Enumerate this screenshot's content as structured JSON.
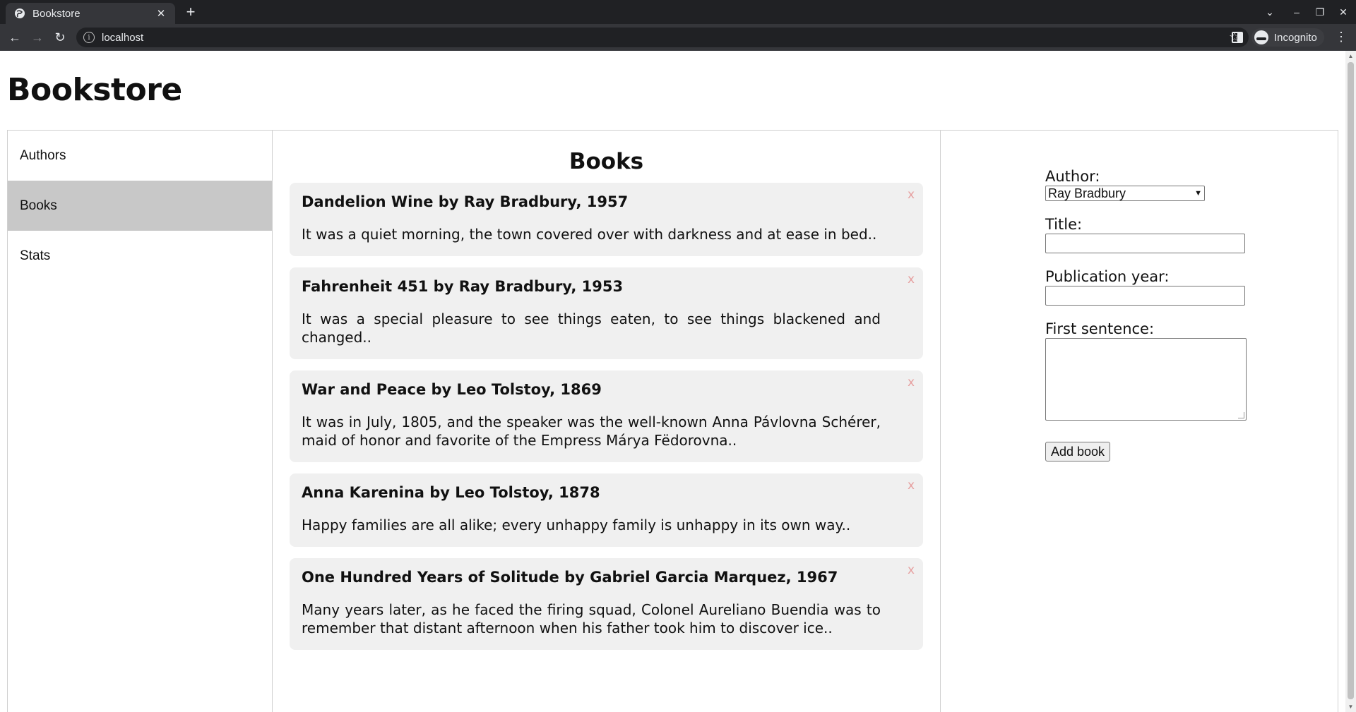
{
  "browser": {
    "tab_title": "Bookstore",
    "url": "localhost",
    "profile_label": "Incognito"
  },
  "page": {
    "title": "Bookstore"
  },
  "sidebar": {
    "items": [
      {
        "label": "Authors",
        "active": false
      },
      {
        "label": "Books",
        "active": true
      },
      {
        "label": "Stats",
        "active": false
      }
    ]
  },
  "main": {
    "title": "Books",
    "books": [
      {
        "heading": "Dandelion Wine by Ray Bradbury, 1957",
        "sentence": "It was a quiet morning, the town covered over with darkness and at ease in bed..",
        "close": "x"
      },
      {
        "heading": "Fahrenheit 451 by Ray Bradbury, 1953",
        "sentence": "It was a special pleasure to see things eaten, to see things blackened and changed..",
        "close": "x"
      },
      {
        "heading": "War and Peace by Leo Tolstoy, 1869",
        "sentence": "It was in July, 1805, and the speaker was the well-known Anna Pávlovna Schérer, maid of honor and favorite of the Empress Márya Fëdorovna..",
        "close": "x"
      },
      {
        "heading": "Anna Karenina by Leo Tolstoy, 1878",
        "sentence": "Happy families are all alike; every unhappy family is unhappy in its own way..",
        "close": "x"
      },
      {
        "heading": "One Hundred Years of Solitude by Gabriel Garcia Marquez, 1967",
        "sentence": "Many years later, as he faced the firing squad, Colonel Aureliano Buendia was to remember that distant afternoon when his father took him to discover ice..",
        "close": "x"
      }
    ]
  },
  "form": {
    "author_label": "Author:",
    "author_value": "Ray Bradbury",
    "title_label": "Title:",
    "title_value": "",
    "year_label": "Publication year:",
    "year_value": "",
    "sentence_label": "First sentence:",
    "sentence_value": "",
    "submit_label": "Add book"
  },
  "colors": {
    "active_sidebar": "#c8c8c8",
    "card_background": "#f0f0f0",
    "close_icon": "#e6a0a0"
  }
}
